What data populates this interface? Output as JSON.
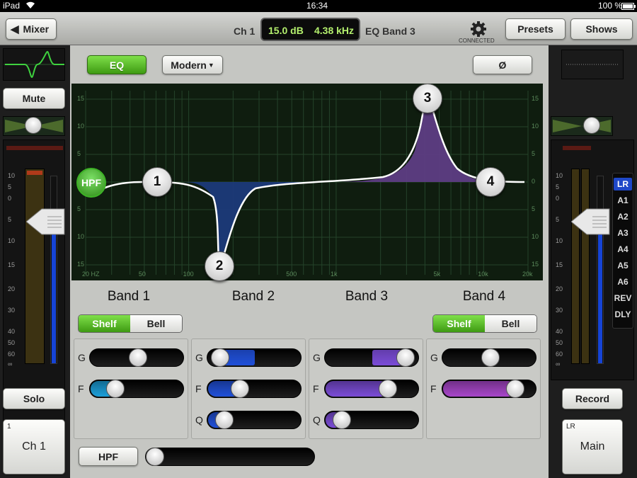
{
  "status": {
    "device": "iPad",
    "time": "16:34",
    "battery": "100 %"
  },
  "topbar": {
    "back_label": "Mixer",
    "channel": "Ch 1",
    "gain_readout": "15.0 dB",
    "freq_readout": "4.38 kHz",
    "band_label": "EQ Band 3",
    "connected_label": "CONNECTED",
    "presets_label": "Presets",
    "shows_label": "Shows"
  },
  "left_strip": {
    "mute_label": "Mute",
    "solo_label": "Solo",
    "channel_number": "1",
    "channel_name": "Ch 1",
    "scale": [
      "10",
      "5",
      "0",
      "5",
      "10",
      "15",
      "20",
      "30",
      "40",
      "50",
      "60",
      "∞"
    ]
  },
  "eq": {
    "eq_label": "EQ",
    "mode_label": "Modern",
    "phase_label": "Ø",
    "graph": {
      "db_labels": [
        "15",
        "10",
        "5",
        "0",
        "5",
        "10",
        "15"
      ],
      "freq_labels": [
        "20 HZ",
        "50",
        "100",
        "500",
        "1k",
        "5k",
        "10k",
        "20k"
      ],
      "hpf_node": "HPF",
      "nodes": [
        "1",
        "2",
        "3",
        "4"
      ]
    },
    "bands": [
      {
        "name": "Band 1",
        "shape": [
          "Shelf",
          "Bell"
        ],
        "active": "Shelf",
        "g": 0.52,
        "f": 0.22,
        "color": "#1a9ed8"
      },
      {
        "name": "Band 2",
        "g": 0.05,
        "f": 0.31,
        "q": 0.1,
        "color": "#1f4fd8"
      },
      {
        "name": "Band 3",
        "g": 0.95,
        "f": 0.72,
        "q": 0.1,
        "color": "#7a4bd6"
      },
      {
        "name": "Band 4",
        "shape": [
          "Shelf",
          "Bell"
        ],
        "active": "Shelf",
        "g": 0.52,
        "f": 0.85,
        "color": "#a745c9"
      }
    ],
    "param_labels": {
      "g": "G",
      "f": "F",
      "q": "Q"
    },
    "hpf_label": "HPF",
    "hpf_value": 0.0
  },
  "right_strip": {
    "record_label": "Record",
    "bus_name": "LR",
    "main_label": "Main",
    "buses": [
      "LR",
      "A1",
      "A2",
      "A3",
      "A4",
      "A5",
      "A6",
      "REV",
      "DLY"
    ],
    "active_bus": "LR"
  }
}
